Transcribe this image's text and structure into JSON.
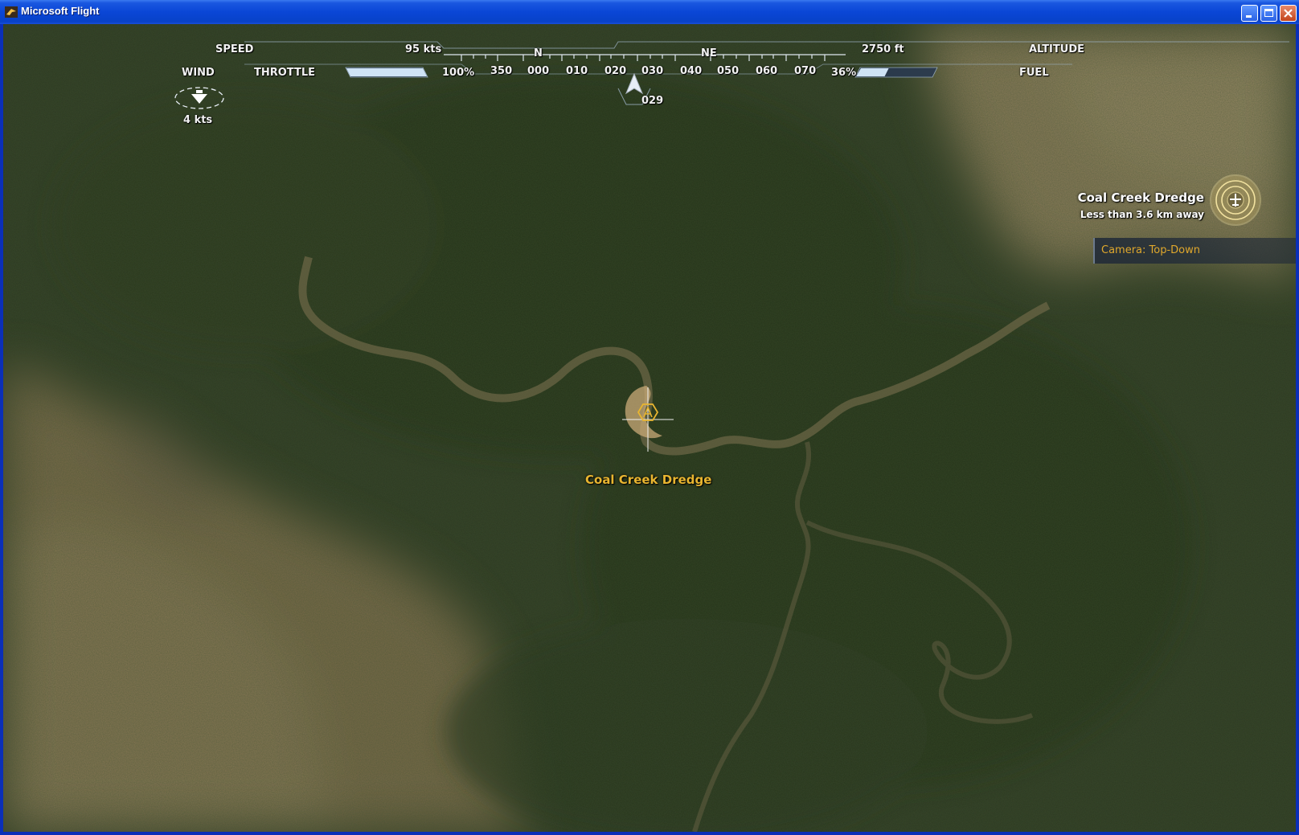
{
  "window": {
    "title": "Microsoft Flight"
  },
  "hud": {
    "speed_label": "SPEED",
    "speed_value": "95 kts",
    "throttle_label": "THROTTLE",
    "throttle_value": "100%",
    "throttle_level": 1.0,
    "wind_label": "WIND",
    "wind_value": "4  kts",
    "altitude_label": "ALTITUDE",
    "altitude_value": "2750 ft",
    "fuel_label": "FUEL",
    "fuel_value": "36%",
    "fuel_level": 0.36,
    "heading_value": "029",
    "compass_letters": [
      "N",
      "NE"
    ],
    "compass_ticks": [
      "350",
      "000",
      "010",
      "020",
      "030",
      "040",
      "050",
      "060",
      "070"
    ]
  },
  "destination_marker": {
    "label": "Coal Creek Dredge"
  },
  "poi_panel": {
    "title": "Coal Creek Dredge",
    "subtitle": "Less than 3.6 km away"
  },
  "camera": {
    "label": "Camera: Top-Down"
  },
  "colors": {
    "hud_text": "#f2f2f2",
    "marker": "#e8b530",
    "camera_text": "#e0a82c",
    "titlebar": "#0a46d6"
  }
}
